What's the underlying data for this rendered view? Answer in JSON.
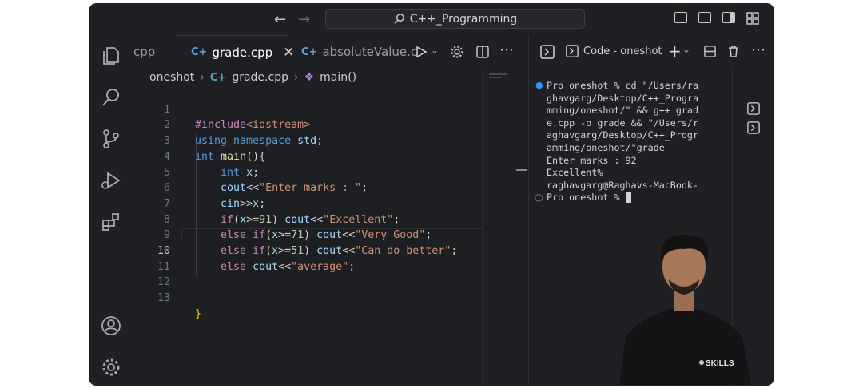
{
  "window": {
    "command_center": "C++_Programming"
  },
  "tabs": [
    {
      "label": "cpp",
      "active": false
    },
    {
      "label": "grade.cpp",
      "active": true
    },
    {
      "label": "absoluteValue.c",
      "active": false
    }
  ],
  "breadcrumb": {
    "folder": "oneshot",
    "file": "grade.cpp",
    "symbol": "main()"
  },
  "editor": {
    "line_numbers": [
      "1",
      "2",
      "3",
      "4",
      "5",
      "6",
      "7",
      "8",
      "9",
      "10",
      "11",
      "12",
      "13"
    ],
    "current_line": "10",
    "lines": {
      "l1": {
        "a": "#include",
        "b": "<iostream>"
      },
      "l2": {
        "a": "using",
        "b": "namespace",
        "c": "std",
        "d": ";"
      },
      "l3": {
        "a": "int",
        "b": "main",
        "c": "(){"
      },
      "l4": {
        "a": "int",
        "b": "x",
        "c": ";"
      },
      "l5": {
        "a": "cout",
        "b": "<<",
        "c": "\"Enter marks : \"",
        "d": ";"
      },
      "l6": {
        "a": "cin",
        "b": ">>",
        "c": "x",
        "d": ";"
      },
      "l7": {
        "a": "if",
        "b": "(",
        "c": "x",
        "d": ">=",
        "e": "91",
        "f": ")",
        "g": "cout",
        "h": "<<",
        "i": "\"Excellent\"",
        "j": ";"
      },
      "l8": {
        "a": "else if",
        "b": "(",
        "c": "x",
        "d": ">=",
        "e": "71",
        "f": ")",
        "g": "cout",
        "h": "<<",
        "i": "\"Very Good\"",
        "j": ";"
      },
      "l9": {
        "a": "else if",
        "b": "(",
        "c": "x",
        "d": ">=",
        "e": "51",
        "f": ")",
        "g": "cout",
        "h": "<<",
        "i": "\"Can do better\"",
        "j": ";"
      },
      "l10": {
        "a": "else",
        "b": "cout",
        "c": "<<",
        "d": "\"average\"",
        "e": ";"
      },
      "l13": {
        "a": "}"
      }
    }
  },
  "panel": {
    "terminal_label": "Code - oneshot"
  },
  "terminal": {
    "lines": [
      "Pro oneshot % cd \"/Users/ra",
      "ghavgarg/Desktop/C++_Progra",
      "mming/oneshot/\" && g++ grad",
      "e.cpp -o grade && \"/Users/r",
      "aghavgarg/Desktop/C++_Progr",
      "amming/oneshot/\"grade",
      "Enter marks : 92",
      "Excellent%",
      "raghavgarg@Raghavs-MacBook-",
      "Pro oneshot % "
    ]
  },
  "webcam": {
    "shirt_text": "SKILLS"
  },
  "colors": {
    "accent": "#5a9fd4",
    "editor_bg": "#1e1f22",
    "keyword": "#569cd6",
    "string": "#ce9178",
    "preprocessor": "#c586c0"
  }
}
